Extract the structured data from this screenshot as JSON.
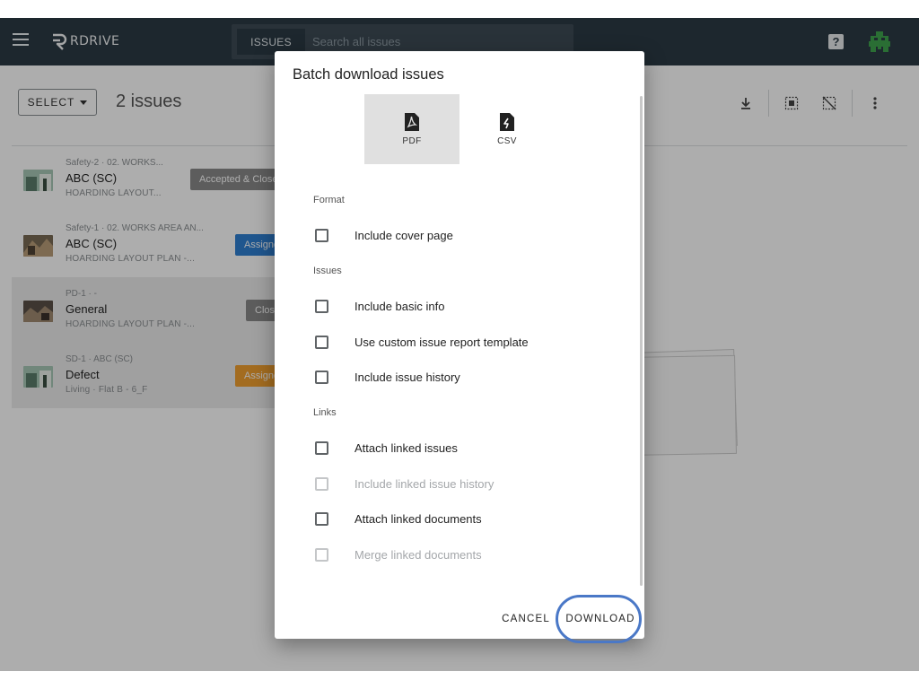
{
  "app": {
    "brand": "RDRIVE",
    "search_tab": "ISSUES",
    "search_placeholder": "Search all issues",
    "help": "?"
  },
  "toolbar": {
    "select_label": "SELECT",
    "count_label": "2 issues"
  },
  "issues": [
    {
      "meta": "Safety-2 · 02. WORKS...",
      "title": "ABC (SC)",
      "sub": "HOARDING LAYOUT...",
      "status": "Accepted & Closed",
      "status_color": "#8a8a8a"
    },
    {
      "meta": "Safety-1 · 02. WORKS AREA AN...",
      "title": "ABC (SC)",
      "sub": "HOARDING LAYOUT PLAN -...",
      "status": "Assigned",
      "status_color": "#2f7fd1"
    },
    {
      "meta": "PD-1 · -",
      "title": "General",
      "sub": "HOARDING LAYOUT PLAN -...",
      "status": "Closed",
      "status_color": "#8a8a8a"
    },
    {
      "meta": "SD-1 · ABC (SC)",
      "title": "Defect",
      "sub": "Living · Flat B - 6_F",
      "status": "Assigned",
      "status_color": "#f0a030"
    }
  ],
  "dialog": {
    "title": "Batch download issues",
    "formats": [
      {
        "label": "PDF",
        "icon": "pdf-file-icon",
        "active": true
      },
      {
        "label": "CSV",
        "icon": "csv-file-icon",
        "active": false
      }
    ],
    "sections": {
      "format": "Format",
      "issues": "Issues",
      "links": "Links"
    },
    "options": {
      "cover_page": "Include cover page",
      "basic_info": "Include basic info",
      "custom_template": "Use custom issue report template",
      "issue_history": "Include issue history",
      "attach_linked_issues": "Attach linked issues",
      "linked_issue_history": "Include linked issue history",
      "attach_linked_documents": "Attach linked documents",
      "merge_linked_documents": "Merge linked documents"
    },
    "cancel_label": "CANCEL",
    "download_label": "DOWNLOAD"
  },
  "colors": {
    "appbar": "#2b3a45",
    "highlight": "#4a78c7"
  }
}
